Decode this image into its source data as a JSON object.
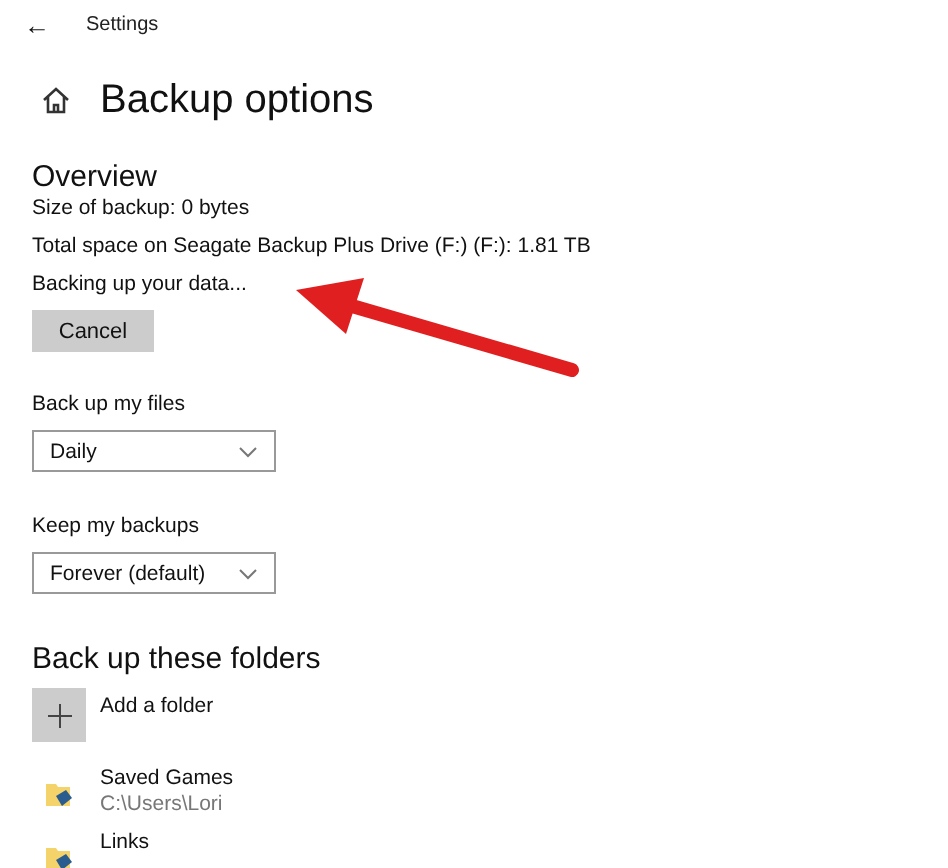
{
  "window": {
    "title": "Settings",
    "back": "←"
  },
  "page": {
    "title": "Backup options"
  },
  "overview": {
    "heading": "Overview",
    "lines": [
      "Size of backup: 0 bytes",
      "Total space on Seagate Backup Plus Drive (F:) (F:): 1.81 TB",
      "Backing up your data..."
    ],
    "button": "Cancel"
  },
  "settings": [
    {
      "label": "Back up my files",
      "value": "Daily"
    },
    {
      "label": "Keep my backups",
      "value": "Forever (default)"
    }
  ],
  "folders": {
    "heading": "Back up these folders",
    "add": "Add a folder",
    "items": [
      {
        "name": "Saved Games",
        "path": "C:\\Users\\Lori"
      },
      {
        "name": "Links"
      }
    ]
  }
}
